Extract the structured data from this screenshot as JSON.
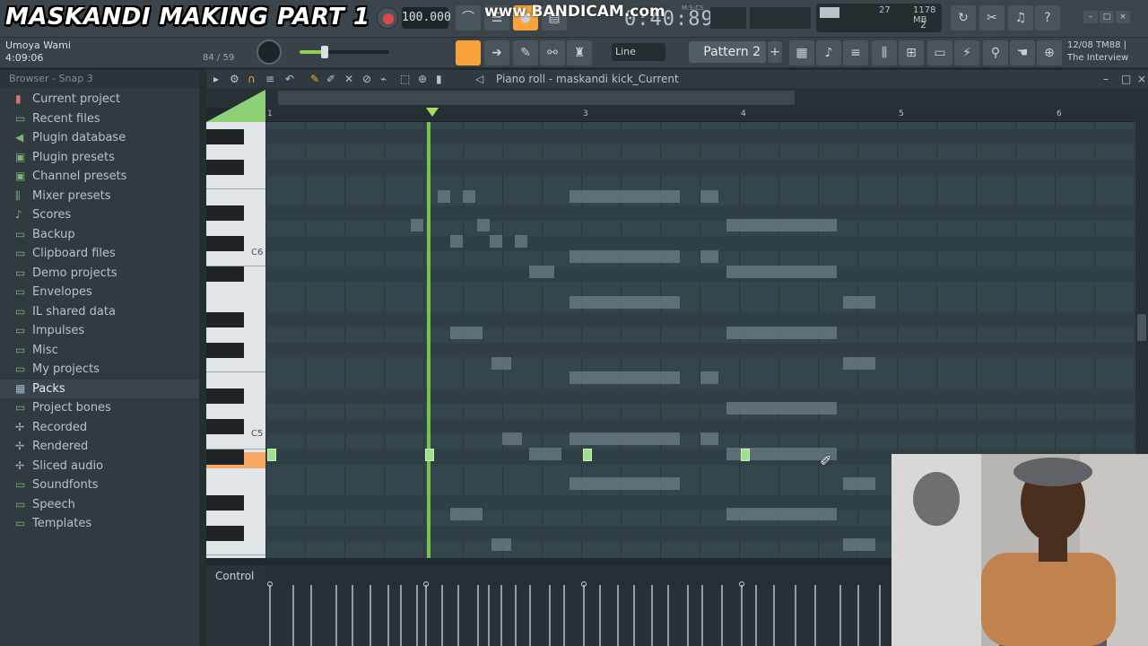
{
  "overlay_title": "MASKANDI MAKING PART 1",
  "watermark": "www.BANDICAM.com",
  "toolbar": {
    "tempo": "100.000",
    "timecode": "0:40:89",
    "time_format": "M:S:CS",
    "cpu": "27",
    "memory": "1178 MB",
    "polyphony": "2",
    "snap_mode": "Line",
    "pattern": "Pattern 2"
  },
  "song": {
    "title": "Umoya Wami",
    "length": "4:09:06",
    "count": "84 / 59"
  },
  "news": {
    "date": "12/08",
    "source": "TM88 |",
    "headline": "The Interview"
  },
  "browser": {
    "header": "Browser - Snap 3",
    "items": [
      {
        "label": "Current project",
        "icon": "project-icon"
      },
      {
        "label": "Recent files",
        "icon": "folder-icon"
      },
      {
        "label": "Plugin database",
        "icon": "plugin-icon"
      },
      {
        "label": "Plugin presets",
        "icon": "preset-icon"
      },
      {
        "label": "Channel presets",
        "icon": "preset-icon"
      },
      {
        "label": "Mixer presets",
        "icon": "mixer-icon"
      },
      {
        "label": "Scores",
        "icon": "note-icon"
      },
      {
        "label": "Backup",
        "icon": "folder-icon"
      },
      {
        "label": "Clipboard files",
        "icon": "folder-icon"
      },
      {
        "label": "Demo projects",
        "icon": "folder-icon"
      },
      {
        "label": "Envelopes",
        "icon": "folder-icon"
      },
      {
        "label": "IL shared data",
        "icon": "folder-icon"
      },
      {
        "label": "Impulses",
        "icon": "folder-icon"
      },
      {
        "label": "Misc",
        "icon": "folder-icon"
      },
      {
        "label": "My projects",
        "icon": "folder-icon"
      },
      {
        "label": "Packs",
        "icon": "packs-icon",
        "selected": true
      },
      {
        "label": "Project bones",
        "icon": "folder-icon"
      },
      {
        "label": "Recorded",
        "icon": "audio-icon"
      },
      {
        "label": "Rendered",
        "icon": "audio-icon"
      },
      {
        "label": "Sliced audio",
        "icon": "audio-icon"
      },
      {
        "label": "Soundfonts",
        "icon": "folder-icon"
      },
      {
        "label": "Speech",
        "icon": "folder-icon"
      },
      {
        "label": "Templates",
        "icon": "folder-icon"
      }
    ]
  },
  "piano_roll": {
    "title": "Piano roll - maskandi kick_Current",
    "bars": [
      "1",
      "3",
      "4",
      "5",
      "6"
    ],
    "key_labels": [
      "C6",
      "C5"
    ],
    "control_label": "Control",
    "playhead_bar": 2
  },
  "colors": {
    "accent": "#f7a23a",
    "note": "#9ee08b",
    "playhead": "#7fd04b",
    "bg": "#34454c"
  }
}
